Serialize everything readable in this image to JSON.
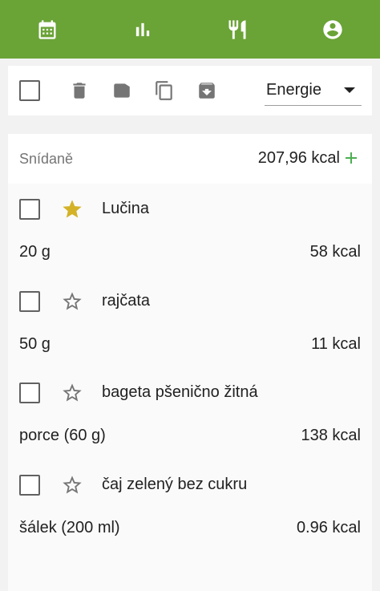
{
  "nav": {
    "items": [
      {
        "icon": "calendar-icon"
      },
      {
        "icon": "bar-chart-icon"
      },
      {
        "icon": "fork-knife-icon"
      },
      {
        "icon": "account-circle-icon"
      }
    ]
  },
  "toolbar": {
    "select_value": "Energie",
    "icons": [
      "checkbox",
      "delete-icon",
      "label-icon",
      "copy-icon",
      "archive-icon"
    ]
  },
  "meal": {
    "name": "Snídaně",
    "total": "207,96  kcal"
  },
  "items": [
    {
      "name": "Lučina",
      "amount": "20 g",
      "kcal": "58  kcal",
      "favorite": true
    },
    {
      "name": "rajčata",
      "amount": "50 g",
      "kcal": "11  kcal",
      "favorite": false
    },
    {
      "name": "bageta pšenično žitná",
      "amount": "porce (60 g)",
      "kcal": "138  kcal",
      "favorite": false
    },
    {
      "name": "čaj zelený bez cukru",
      "amount": "šálek (200 ml)",
      "kcal": "0.96  kcal",
      "favorite": false
    }
  ],
  "colors": {
    "topbar": "#6aa336",
    "star_filled": "#d4b227",
    "add": "#4caf50"
  }
}
